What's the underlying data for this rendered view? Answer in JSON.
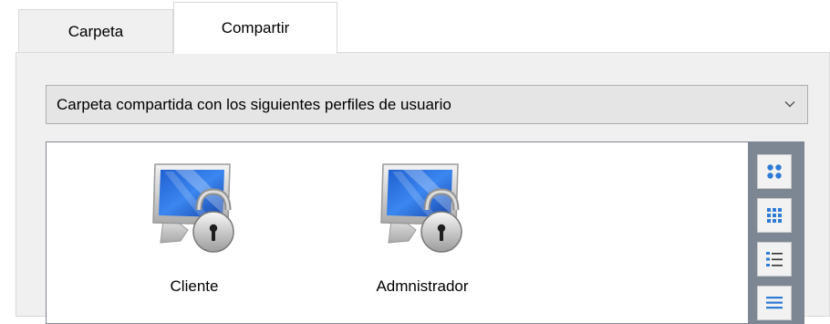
{
  "tabs": [
    {
      "label": "Carpeta",
      "active": false
    },
    {
      "label": "Compartir",
      "active": true
    }
  ],
  "share_select": {
    "value": "Carpeta compartida con los siguientes perfiles de usuario",
    "icon": "chevron-down-icon"
  },
  "profiles": [
    {
      "label": "Cliente",
      "icon": "locked-monitor-icon"
    },
    {
      "label": "Admnistrador",
      "icon": "locked-monitor-icon"
    }
  ],
  "view_buttons": [
    {
      "name": "large-icons-view",
      "icon": "large-icons-view-icon"
    },
    {
      "name": "small-icons-view",
      "icon": "small-icons-view-icon"
    },
    {
      "name": "list-view",
      "icon": "list-view-icon"
    },
    {
      "name": "details-view",
      "icon": "details-view-icon"
    }
  ],
  "colors": {
    "panel_bg": "#f0f0f0",
    "select_bg": "#e5e5e5",
    "viewbar_bg": "#7d8793",
    "icon_accent": "#2e7bd6"
  }
}
